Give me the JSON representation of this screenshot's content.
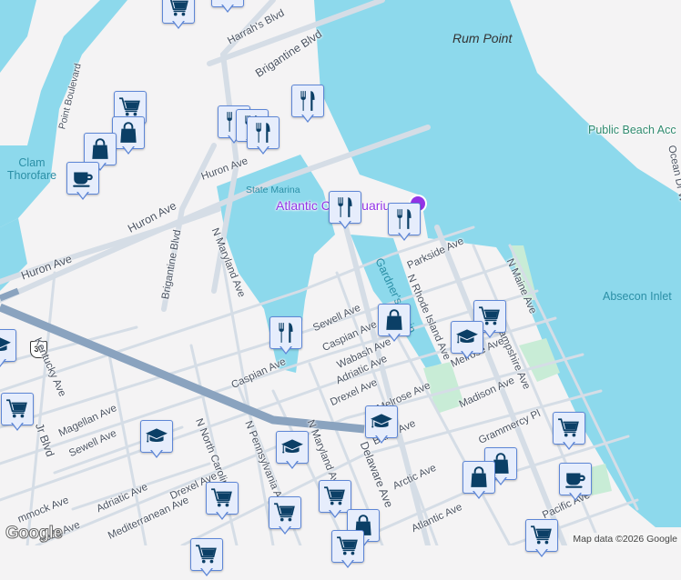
{
  "map": {
    "places": {
      "rum_point": "Rum Point",
      "public_beach": "Public Beach Acc",
      "clam_thorofare": "Clam Thorofare",
      "state_marina": "State Marina",
      "aquarium": "Atlantic City Aquarium",
      "gardners_basin": "Gardner's Basin",
      "absecon_inlet": "Absecon Inlet"
    },
    "streets": {
      "harrahs": "Harrah's Blvd",
      "brigantine1": "Brigantine Blvd",
      "brigantine2": "Brigantine Blvd",
      "ocean_dr": "Ocean Dr W",
      "point_blvd": "Point Boulevard",
      "huron1": "Huron Ave",
      "huron2": "Huron Ave",
      "huron3": "Huron Ave",
      "n_maryland1": "N Maryland Ave",
      "parkside": "Parkside Ave",
      "n_rhode_island": "N Rhode Island Ave",
      "n_maine": "N Maine Ave",
      "n_new_hampshire": "ampshire Ave",
      "sewell1": "Sewell Ave",
      "caspian1": "Caspian Ave",
      "wabash": "Wabash Ave",
      "adriatic1": "Adriatic Ave",
      "drexel1": "Drexel Ave",
      "melrose1": "Melrose Ave",
      "melrose2": "Melrose Ave",
      "madison": "Madison Ave",
      "caspian2": "Caspian Ave",
      "kentucky": "Kentucky Ave",
      "mlk": "Jr Blvd",
      "magellan": "Magellan Ave",
      "sewell2": "Sewell Ave",
      "n_north_carolina": "N North Carolina Ave",
      "n_pennsylvania": "N Pennsylvania Ave",
      "n_maryland2": "N Maryland Ave",
      "delaware": "Delaware Ave",
      "baltic": "Baltic Ave",
      "grammercy": "Grammercy Pl",
      "arctic": "Arctic Ave",
      "atlantic": "Atlantic Ave",
      "pacific": "Pacific Ave",
      "adriatic2": "Adriatic Ave",
      "drexel2": "Drexel Ave",
      "mediterranean": "Mediterranean Ave",
      "hammock": "mmock Ave",
      "leeds": "eeds Ave"
    },
    "route_shield": "30",
    "credit": "Map data ©2026 Google",
    "logo": "Google",
    "colors": {
      "water": "#8dd9ec",
      "land": "#f4f3f4",
      "road": "#d5dde6",
      "highway": "#8aa3bf",
      "park": "#c8ecd6",
      "marker_icon": "#0b3f66",
      "marker_bg": "#e6edfc"
    }
  },
  "markers": [
    "cart",
    "cart",
    "cart",
    "bag",
    "bag",
    "coffee",
    "restaurant",
    "restaurant",
    "restaurant",
    "restaurant",
    "restaurant",
    "restaurant",
    "bag",
    "cart",
    "school",
    "restaurant",
    "school",
    "cart",
    "school",
    "school",
    "school",
    "cart",
    "bag",
    "bag",
    "coffee",
    "cart",
    "cart",
    "cart",
    "cart",
    "bag",
    "cart",
    "cart"
  ]
}
